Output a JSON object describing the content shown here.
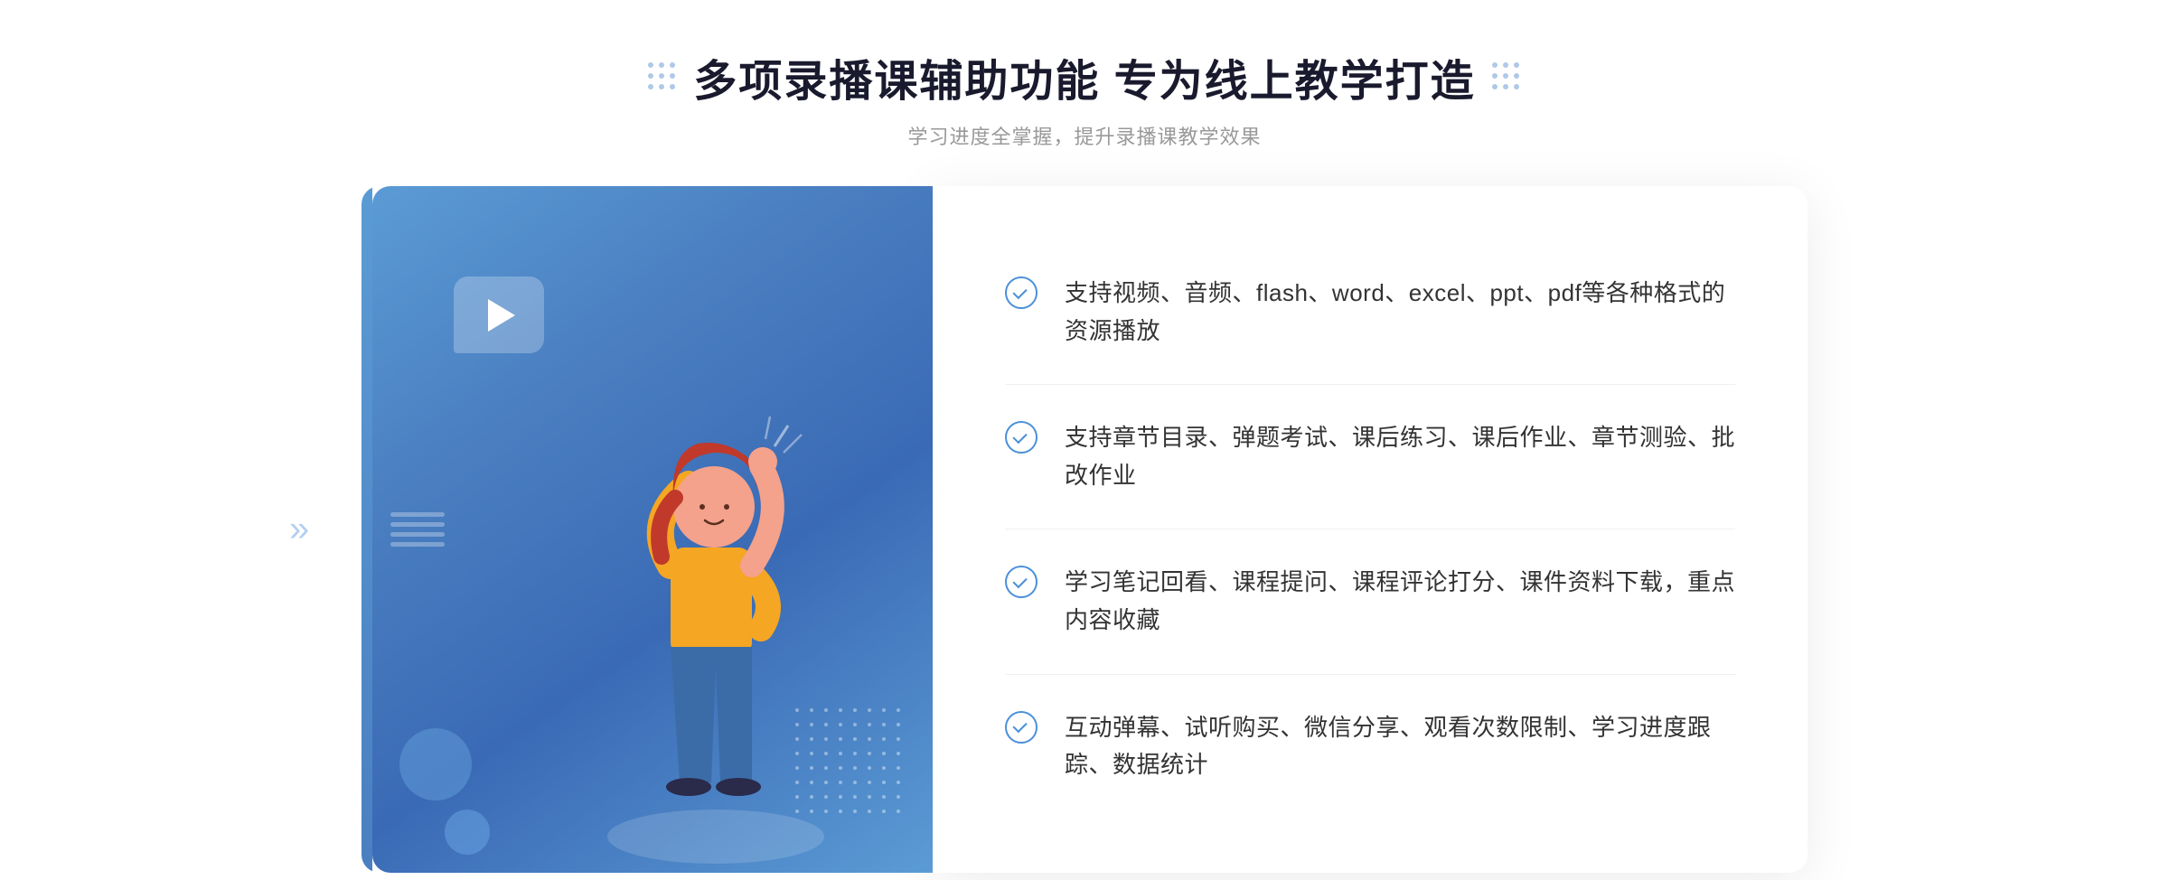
{
  "header": {
    "main_title": "多项录播课辅助功能 专为线上教学打造",
    "subtitle": "学习进度全掌握，提升录播课教学效果"
  },
  "features": [
    {
      "id": 1,
      "text": "支持视频、音频、flash、word、excel、ppt、pdf等各种格式的资源播放"
    },
    {
      "id": 2,
      "text": "支持章节目录、弹题考试、课后练习、课后作业、章节测验、批改作业"
    },
    {
      "id": 3,
      "text": "学习笔记回看、课程提问、课程评论打分、课件资料下载，重点内容收藏"
    },
    {
      "id": 4,
      "text": "互动弹幕、试听购买、微信分享、观看次数限制、学习进度跟踪、数据统计"
    }
  ]
}
